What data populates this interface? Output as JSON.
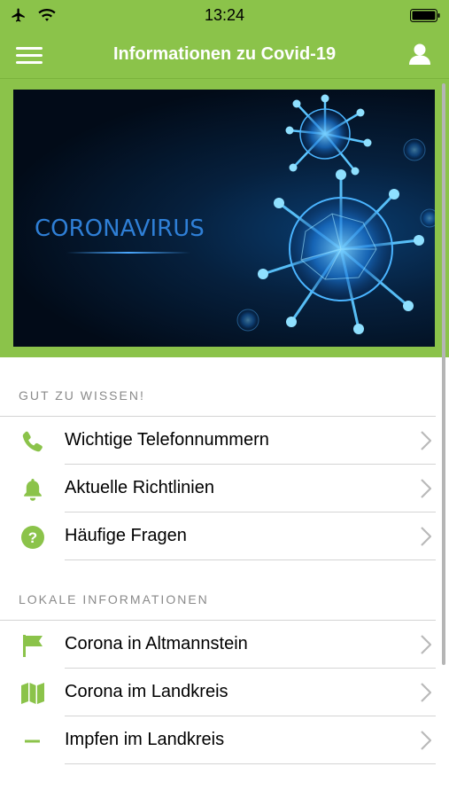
{
  "status": {
    "time": "13:24"
  },
  "header": {
    "title": "Informationen zu Covid-19"
  },
  "hero": {
    "text": "CORONAVIRUS"
  },
  "sections": [
    {
      "title": "GUT ZU WISSEN!",
      "items": [
        {
          "label": "Wichtige Telefonnummern",
          "icon": "phone-icon"
        },
        {
          "label": "Aktuelle Richtlinien",
          "icon": "bell-icon"
        },
        {
          "label": "Häufige Fragen",
          "icon": "question-icon"
        }
      ]
    },
    {
      "title": "LOKALE INFORMATIONEN",
      "items": [
        {
          "label": "Corona in Altmannstein",
          "icon": "flag-icon"
        },
        {
          "label": "Corona im Landkreis",
          "icon": "map-icon"
        },
        {
          "label": "Impfen im Landkreis",
          "icon": "dash-icon"
        }
      ]
    }
  ],
  "colors": {
    "brand": "#8bc34a",
    "icon": "#8bc34a"
  }
}
